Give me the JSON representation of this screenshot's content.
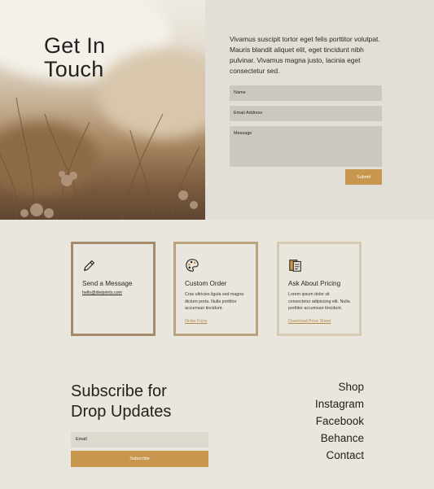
{
  "hero": {
    "title": "Get In\nTouch",
    "intro": "Vivamus suscipit tortor eget felis porttitor volutpat. Mauris blandit aliquet elit, eget tincidunt nibh pulvinar. Vivamus magna justo, lacinia eget consectetur sed.",
    "form": {
      "name_placeholder": "Name",
      "email_placeholder": "Email Address",
      "message_placeholder": "Message",
      "submit_label": "Submit"
    }
  },
  "cards": [
    {
      "icon": "pencil-icon",
      "title": "Send a Message",
      "body": "",
      "link": "hello@diviprints.com"
    },
    {
      "icon": "palette-icon",
      "title": "Custom Order",
      "body": "Cras ultricies ligula sed magna dictum porta. Nulla porttitor accumsan tincidunt.",
      "link": "Order Form"
    },
    {
      "icon": "clipboard-icon",
      "title": "Ask About Pricing",
      "body": "Lorem ipsum dolor sit consectetur adipiscing elit. Nulla porttitor accumsan tincidunt.",
      "link": "Download Price Sheet"
    }
  ],
  "subscribe": {
    "title": "Subscribe for\nDrop Updates",
    "email_placeholder": "Email",
    "button_label": "Subscribe"
  },
  "footer_nav": [
    "Shop",
    "Instagram",
    "Facebook",
    "Behance",
    "Contact"
  ],
  "colors": {
    "accent": "#c8974e",
    "background": "#e9e6dd",
    "panel": "#e2dfd8",
    "field": "#cbc8c0"
  }
}
